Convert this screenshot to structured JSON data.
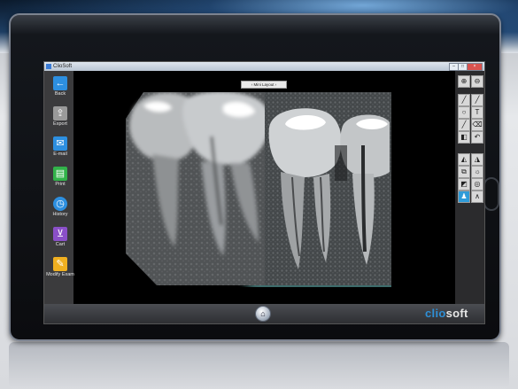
{
  "window": {
    "title": "ClioSoft"
  },
  "toolbar": {
    "layout_button": "Mini Layout"
  },
  "sidebar": {
    "items": [
      {
        "label": "Back",
        "icon": "arrow-left-icon",
        "color": "#2d8fe0"
      },
      {
        "label": "Export",
        "icon": "export-icon",
        "color": "#8a8a8a"
      },
      {
        "label": "E-mail",
        "icon": "mail-icon",
        "color": "#2d8fe0"
      },
      {
        "label": "Print",
        "icon": "printer-icon",
        "color": "#32b34a"
      },
      {
        "label": "History",
        "icon": "clock-icon",
        "color": "#2d8fe0"
      },
      {
        "label": "Cart",
        "icon": "cart-icon",
        "color": "#8a4fc8"
      },
      {
        "label": "Modify Exam",
        "icon": "pencil-icon",
        "color": "#f0b020"
      }
    ]
  },
  "brand": {
    "part1": "clio",
    "part2": "soft"
  }
}
